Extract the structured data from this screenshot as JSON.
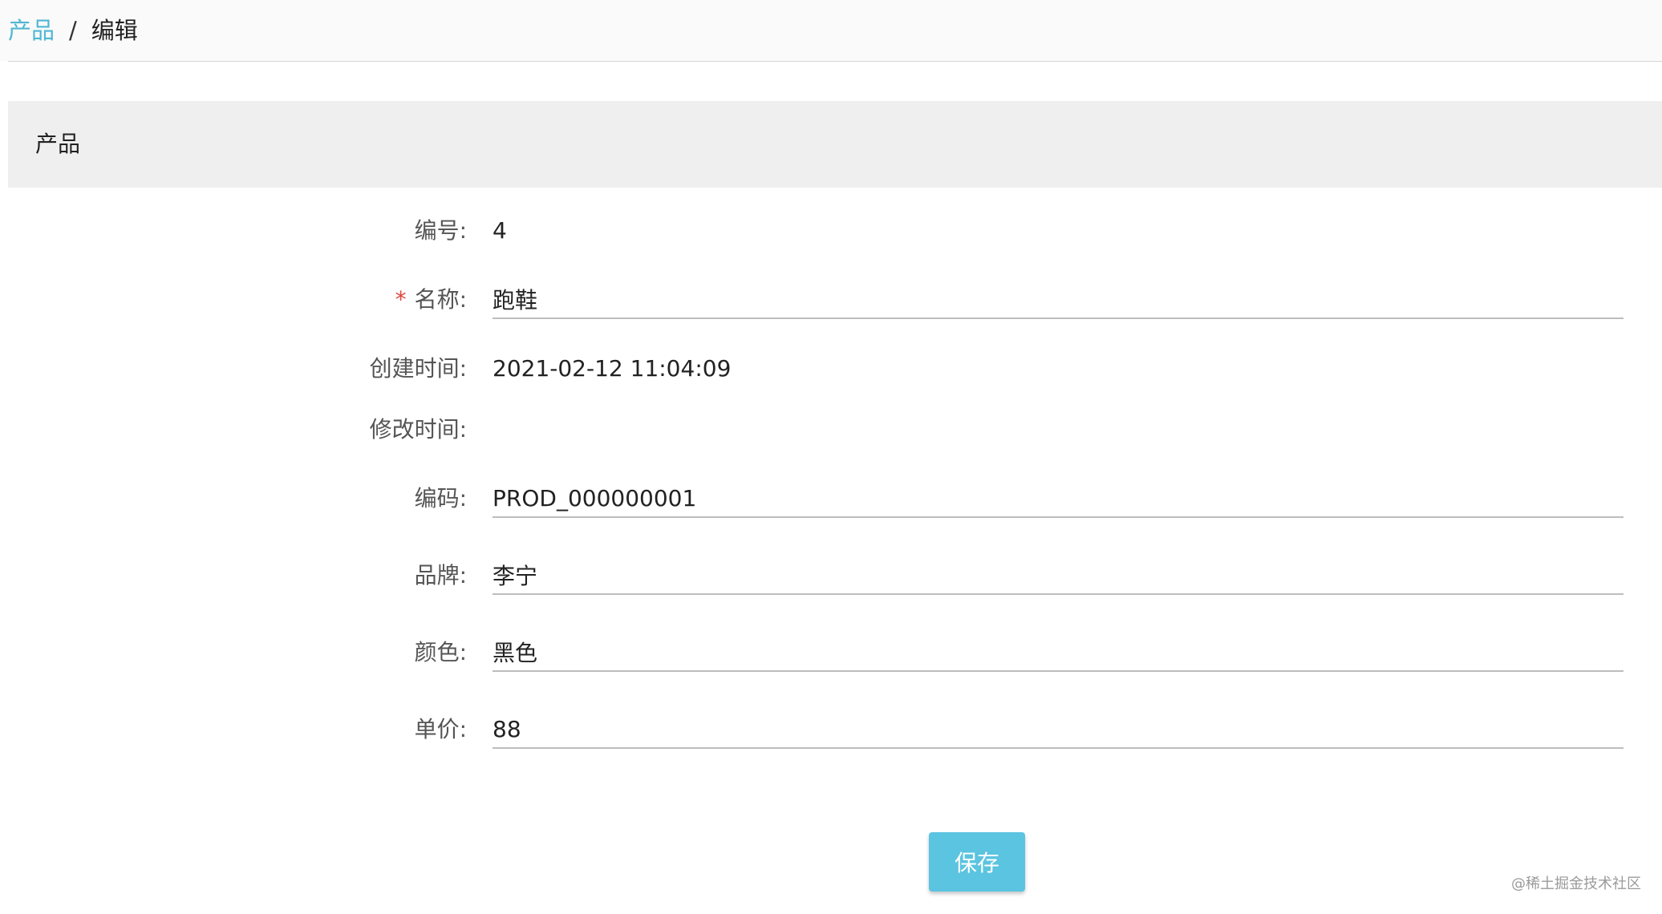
{
  "breadcrumb": {
    "parent": "产品",
    "separator": "/",
    "current": "编辑"
  },
  "section": {
    "title": "产品"
  },
  "form": {
    "id": {
      "label": "编号:",
      "value": "4"
    },
    "name": {
      "label": "名称:",
      "required_mark": "*",
      "value": "跑鞋"
    },
    "created_at": {
      "label": "创建时间:",
      "value": "2021-02-12 11:04:09"
    },
    "modified_at": {
      "label": "修改时间:",
      "value": ""
    },
    "code": {
      "label": "编码:",
      "value": "PROD_000000001"
    },
    "brand": {
      "label": "品牌:",
      "value": "李宁"
    },
    "color": {
      "label": "颜色:",
      "value": "黑色"
    },
    "price": {
      "label": "单价:",
      "value": "88"
    }
  },
  "actions": {
    "save_label": "保存"
  },
  "watermark": "@稀土掘金技术社区",
  "colors": {
    "accent": "#5bc4e0",
    "link": "#4fb7d3",
    "required": "#e0453a",
    "header_bg": "#efefef"
  }
}
